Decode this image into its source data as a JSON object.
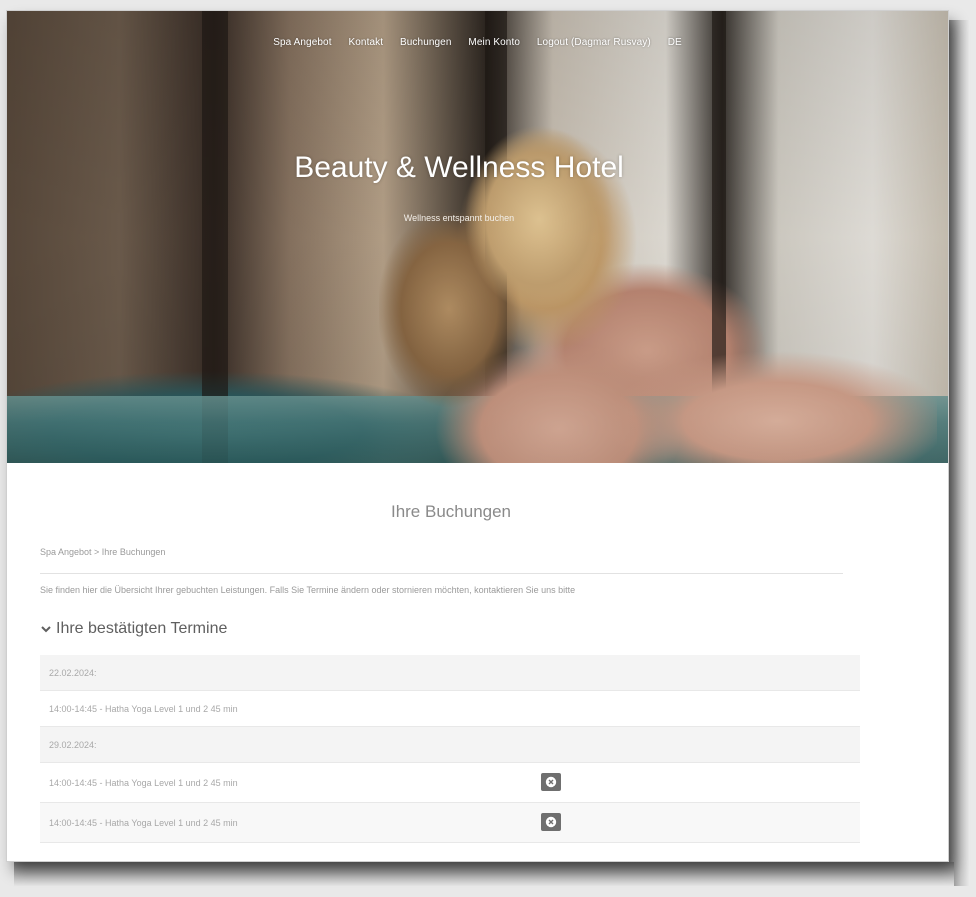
{
  "nav": {
    "items": [
      "Spa Angebot",
      "Kontakt",
      "Buchungen",
      "Mein Konto",
      "Logout (Dagmar Rusvay)",
      "DE"
    ]
  },
  "hero": {
    "title": "Beauty & Wellness Hotel",
    "subtitle": "Wellness entspannt buchen"
  },
  "page": {
    "title": "Ihre Buchungen",
    "breadcrumb": "Spa Angebot > Ihre Buchungen",
    "info": "Sie finden hier die Übersicht Ihrer gebuchten Leistungen. Falls Sie Termine ändern oder stornieren möchten, kontaktieren Sie uns bitte"
  },
  "section": {
    "title": "Ihre bestätigten Termine"
  },
  "bookings": [
    {
      "date": "22.02.2024:",
      "items": [
        "14:00-14:45 - Hatha Yoga Level 1 und 2 45 min"
      ],
      "cancellable": [
        false
      ]
    },
    {
      "date": "29.02.2024:",
      "items": [
        "14:00-14:45 - Hatha Yoga Level 1 und 2 45 min",
        "14:00-14:45 - Hatha Yoga Level 1 und 2 45 min"
      ],
      "cancellable": [
        true,
        true
      ]
    }
  ],
  "icons": {
    "section_toggle": "chevron-down-icon",
    "cancel": "close-circle-icon"
  }
}
